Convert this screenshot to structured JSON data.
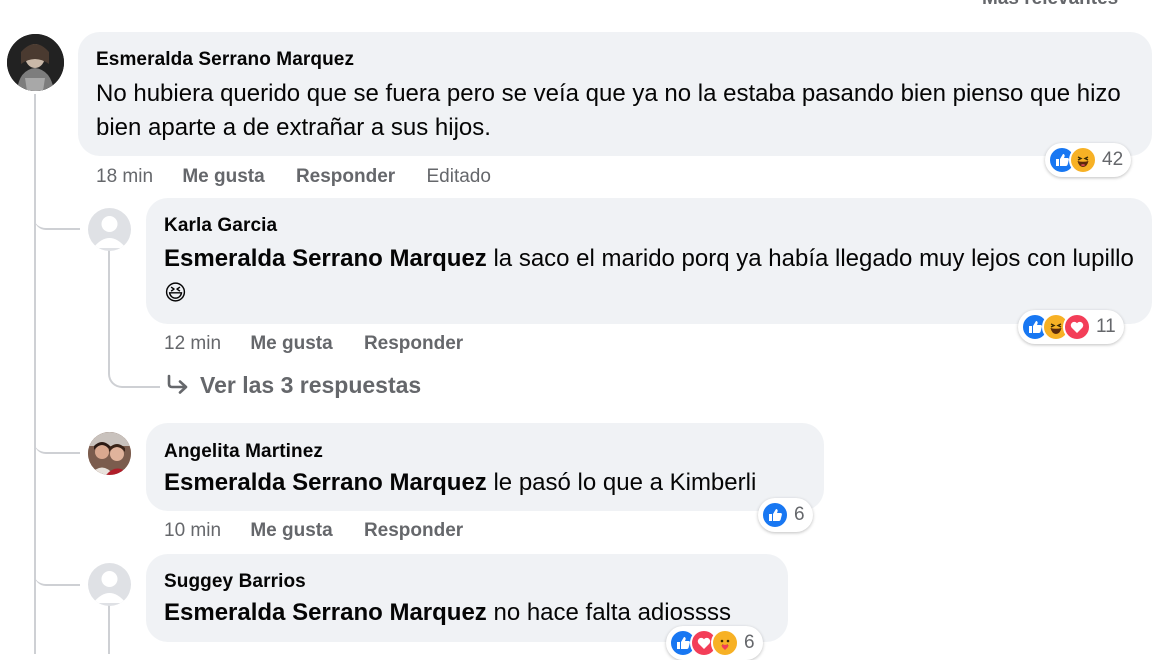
{
  "sort": {
    "label": "Más relevantes"
  },
  "comment_main": {
    "author": "Esmeralda Serrano Marquez",
    "text": "No hubiera querido que se fuera pero se veía que ya no la estaba pasando bien pienso que hizo bien aparte a de extrañar a sus hijos.",
    "time": "18 min",
    "like": "Me gusta",
    "reply": "Responder",
    "edited": "Editado",
    "reaction_count": "42"
  },
  "replies": [
    {
      "author": "Karla Garcia",
      "mention": "Esmeralda Serrano Marquez",
      "text": " la saco el marido porq ya había llegado muy lejos con lupillo",
      "emoji": "😆",
      "time": "12 min",
      "like": "Me gusta",
      "reply": "Responder",
      "reaction_count": "11",
      "view_replies": "Ver las 3 respuestas"
    },
    {
      "author": "Angelita Martinez",
      "mention": "Esmeralda Serrano Marquez",
      "text": " le pasó lo que a Kimberli",
      "time": "10 min",
      "like": "Me gusta",
      "reply": "Responder",
      "reaction_count": "6"
    },
    {
      "author": "Suggey Barrios",
      "mention": "Esmeralda Serrano Marquez",
      "text": " no hace falta adiossss",
      "reaction_count": "6"
    }
  ],
  "icons": {
    "like": "thumbs-up-icon",
    "haha": "haha-face-icon",
    "love": "heart-icon",
    "reply_arrow": "reply-arrow-icon"
  },
  "colors": {
    "like": "#1877f2",
    "haha": "#f7b125",
    "love": "#f33e58",
    "bubble": "#f0f2f5",
    "meta": "#65676b"
  }
}
